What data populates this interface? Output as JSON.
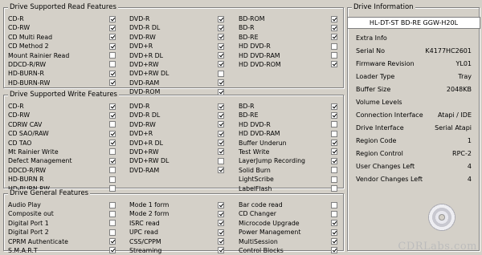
{
  "read": {
    "title": "Drive Supported Read Features",
    "columns": [
      [
        [
          "CD-R",
          true
        ],
        [
          "CD-RW",
          true
        ],
        [
          "CD Multi Read",
          true
        ],
        [
          "CD Method 2",
          true
        ],
        [
          "Mount Rainier Read",
          false
        ],
        [
          "DDCD-R/RW",
          false
        ],
        [
          "HD-BURN-R",
          true
        ],
        [
          "HD-BURN-RW",
          true
        ]
      ],
      [
        [
          "DVD-R",
          true
        ],
        [
          "DVD-R DL",
          true
        ],
        [
          "DVD-RW",
          true
        ],
        [
          "DVD+R",
          true
        ],
        [
          "DVD+R DL",
          true
        ],
        [
          "DVD+RW",
          true
        ],
        [
          "DVD+RW DL",
          false
        ],
        [
          "DVD-RAM",
          true
        ],
        [
          "DVD-ROM",
          true
        ]
      ],
      [
        [
          "BD-ROM",
          true
        ],
        [
          "BD-R",
          true
        ],
        [
          "BD-RE",
          true
        ],
        [
          "HD DVD-R",
          false
        ],
        [
          "HD DVD-RAM",
          false
        ],
        [
          "HD DVD-ROM",
          true
        ]
      ]
    ]
  },
  "write": {
    "title": "Drive Supported Write Features",
    "columns": [
      [
        [
          "CD-R",
          true
        ],
        [
          "CD-RW",
          true
        ],
        [
          "CDRW CAV",
          false
        ],
        [
          "CD SAO/RAW",
          true
        ],
        [
          "CD TAO",
          true
        ],
        [
          "Mt Rainier Write",
          false
        ],
        [
          "Defect Management",
          true
        ],
        [
          "DDCD-R/RW",
          false
        ],
        [
          "HD-BURN R",
          false
        ],
        [
          "HD-BURN RW",
          false
        ]
      ],
      [
        [
          "DVD-R",
          true
        ],
        [
          "DVD-R DL",
          true
        ],
        [
          "DVD-RW",
          true
        ],
        [
          "DVD+R",
          true
        ],
        [
          "DVD+R DL",
          true
        ],
        [
          "DVD+RW",
          true
        ],
        [
          "DVD+RW DL",
          false
        ],
        [
          "DVD-RAM",
          true
        ]
      ],
      [
        [
          "BD-R",
          true
        ],
        [
          "BD-RE",
          true
        ],
        [
          "HD DVD-R",
          false
        ],
        [
          "HD DVD-RAM",
          false
        ],
        [
          "Buffer Underun",
          true
        ],
        [
          "Test Write",
          true
        ],
        [
          "LayerJump Recording",
          true
        ],
        [
          "Solid Burn",
          false
        ],
        [
          "LightScribe",
          false
        ],
        [
          "LabelFlash",
          false
        ]
      ]
    ]
  },
  "general": {
    "title": "Drive General Features",
    "columns": [
      [
        [
          "Audio Play",
          false
        ],
        [
          "Composite out",
          false
        ],
        [
          "Digital Port 1",
          false
        ],
        [
          "Digital Port 2",
          false
        ],
        [
          "CPRM Authenticate",
          true
        ],
        [
          "S.M.A.R.T",
          true
        ]
      ],
      [
        [
          "Mode 1 form",
          true
        ],
        [
          "Mode 2 form",
          true
        ],
        [
          "ISRC read",
          true
        ],
        [
          "UPC read",
          true
        ],
        [
          "CSS/CPPM",
          true
        ],
        [
          "Streaming",
          true
        ]
      ],
      [
        [
          "Bar code read",
          false
        ],
        [
          "CD Changer",
          false
        ],
        [
          "Microcode Upgrade",
          true
        ],
        [
          "Power Management",
          true
        ],
        [
          "MultiSession",
          true
        ],
        [
          "Control Blocks",
          true
        ]
      ]
    ]
  },
  "info": {
    "title": "Drive Information",
    "drive_name": "HL-DT-ST BD-RE  GGW-H20L",
    "rows": [
      [
        "Extra Info",
        ""
      ],
      [
        "Serial No",
        "K4177HC2601"
      ],
      [
        "Firmware Revision",
        "YL01"
      ],
      [
        "Loader Type",
        "Tray"
      ],
      [
        "Buffer Size",
        "2048KB"
      ],
      [
        "Volume Levels",
        ""
      ],
      [
        "Connection Interface",
        "Atapi / IDE"
      ],
      [
        "Drive Interface",
        "Serial Atapi"
      ],
      [
        "Region Code",
        "1"
      ],
      [
        "Region Control",
        "RPC-2"
      ],
      [
        "User Changes Left",
        "4"
      ],
      [
        "Vendor Changes Left",
        "4"
      ]
    ]
  },
  "watermark": "CDRLabs.com"
}
